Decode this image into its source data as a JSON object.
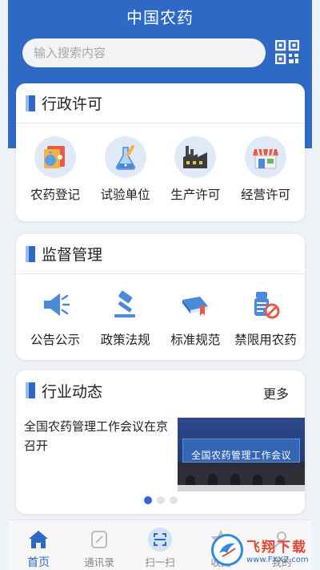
{
  "app": {
    "title": "中国农药"
  },
  "search": {
    "placeholder": "输入搜索内容",
    "value": ""
  },
  "sections": {
    "admin": {
      "title": "行政许可",
      "items": [
        {
          "label": "农药登记",
          "icon": "pesticide-registration-icon"
        },
        {
          "label": "试验单位",
          "icon": "lab-flask-icon"
        },
        {
          "label": "生产许可",
          "icon": "factory-icon"
        },
        {
          "label": "经营许可",
          "icon": "store-icon"
        }
      ]
    },
    "supervision": {
      "title": "监督管理",
      "items": [
        {
          "label": "公告公示",
          "icon": "megaphone-icon"
        },
        {
          "label": "政策法规",
          "icon": "gavel-icon"
        },
        {
          "label": "标准规范",
          "icon": "book-icon"
        },
        {
          "label": "禁限用农药",
          "icon": "banned-pesticide-icon"
        }
      ]
    },
    "news": {
      "title": "行业动态",
      "more": "更多",
      "headline": "全国农药管理工作会议在京召开",
      "image_caption": "全国农药管理工作会议",
      "carousel": {
        "count": 3,
        "active_index": 0
      }
    }
  },
  "tabbar": {
    "tabs": [
      {
        "label": "首页",
        "icon": "home-icon",
        "active": true
      },
      {
        "label": "通讯录",
        "icon": "contacts-icon",
        "active": false
      },
      {
        "label": "扫一扫",
        "icon": "scan-icon",
        "active": false
      },
      {
        "label": "收藏",
        "icon": "favorite-icon",
        "active": false
      },
      {
        "label": "我的",
        "icon": "profile-icon",
        "active": false
      }
    ]
  },
  "watermark": {
    "title": "飞翔下载",
    "url": "www.FXXZ.com"
  },
  "colors": {
    "primary": "#2f69c6",
    "background": "#eef1f6",
    "card": "#ffffff"
  }
}
